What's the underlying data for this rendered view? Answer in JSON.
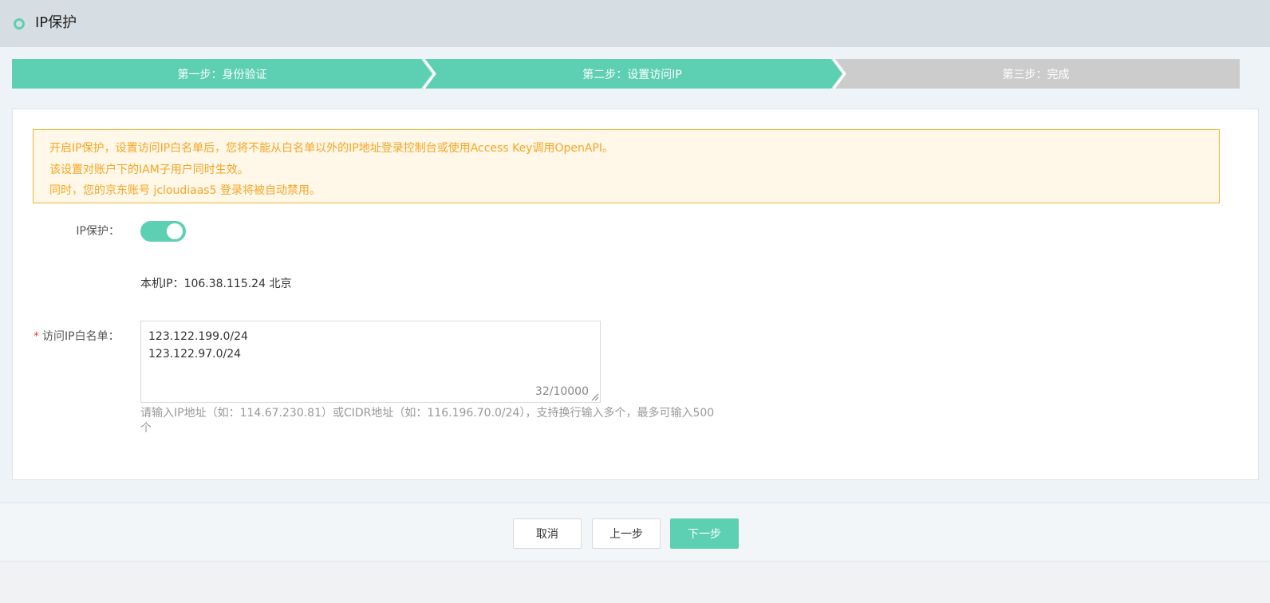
{
  "header": {
    "title": "IP保护"
  },
  "steps": [
    {
      "label": "第一步：身份验证",
      "state": "active"
    },
    {
      "label": "第二步：设置访问IP",
      "state": "active"
    },
    {
      "label": "第三步：完成",
      "state": "inactive"
    }
  ],
  "notice": {
    "lines": [
      "开启IP保护，设置访问IP白名单后，您将不能从白名单以外的IP地址登录控制台或使用Access Key调用OpenAPI。",
      "该设置对账户下的IAM子用户同时生效。",
      "同时，您的京东账号 jcloudiaas5 登录将被自动禁用。"
    ]
  },
  "form": {
    "ip_protect_label": "IP保护：",
    "ip_protect_enabled": true,
    "local_ip": "本机IP：106.38.115.24 北京",
    "whitelist_required": "*",
    "whitelist_label": "访问IP白名单：",
    "whitelist_value": "123.122.199.0/24\n123.122.97.0/24",
    "whitelist_count": "32/10000",
    "whitelist_hint": "请输入IP地址（如：114.67.230.81）或CIDR地址（如：116.196.70.0/24），支持换行输入多个，最多可输入500个"
  },
  "footer": {
    "cancel": "取消",
    "prev": "上一步",
    "next": "下一步"
  },
  "colors": {
    "accent": "#5dd0b3",
    "step_inactive": "#cccccc",
    "notice_text": "#f5a623",
    "notice_border": "#f5b631",
    "notice_bg": "#fff7e8"
  }
}
